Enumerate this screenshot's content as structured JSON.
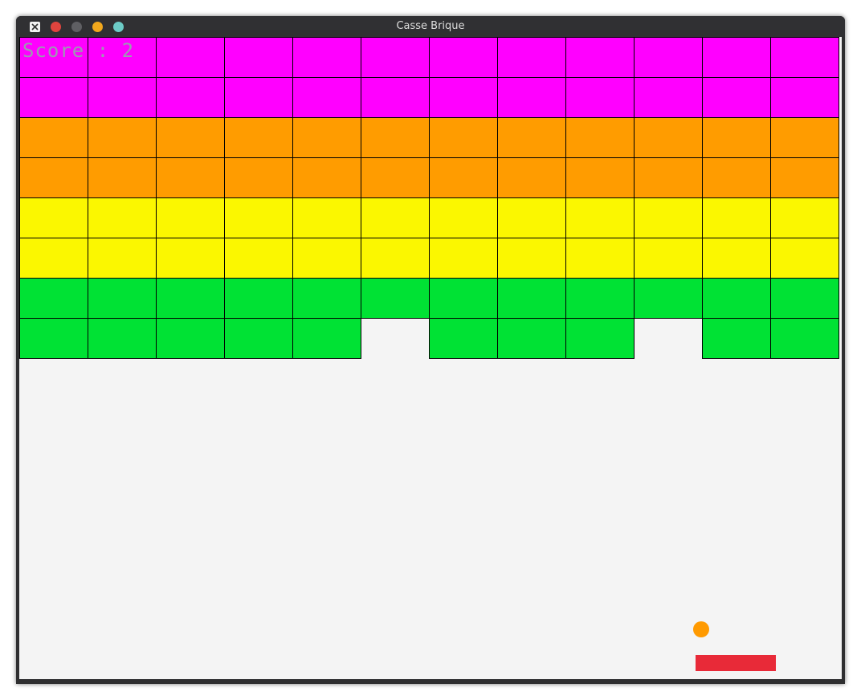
{
  "window": {
    "title": "Casse Brique",
    "buttons": [
      {
        "name": "app-menu-icon",
        "color": "#f2f2f2"
      },
      {
        "name": "close-button",
        "color": "#e0443e"
      },
      {
        "name": "minimize-button",
        "color": "#5f5f63"
      },
      {
        "name": "maximize-button",
        "color": "#f2a81d"
      },
      {
        "name": "sticky-button",
        "color": "#6ccbc6"
      }
    ]
  },
  "game": {
    "score_label": "Score : 2",
    "grid": {
      "columns": 12,
      "rows": 8
    },
    "row_colors": [
      "#ff00ff",
      "#ff00ff",
      "#ff9c00",
      "#ff9c00",
      "#fbf700",
      "#fbf700",
      "#00e234",
      "#00e234"
    ],
    "missing_bricks": [
      {
        "row": 8,
        "column": 6
      },
      {
        "row": 8,
        "column": 10
      }
    ],
    "colors": {
      "background": "#f4f4f4",
      "ball": "#ff9a00",
      "paddle": "#e82a38",
      "score_text": "#9b9bb0"
    }
  }
}
